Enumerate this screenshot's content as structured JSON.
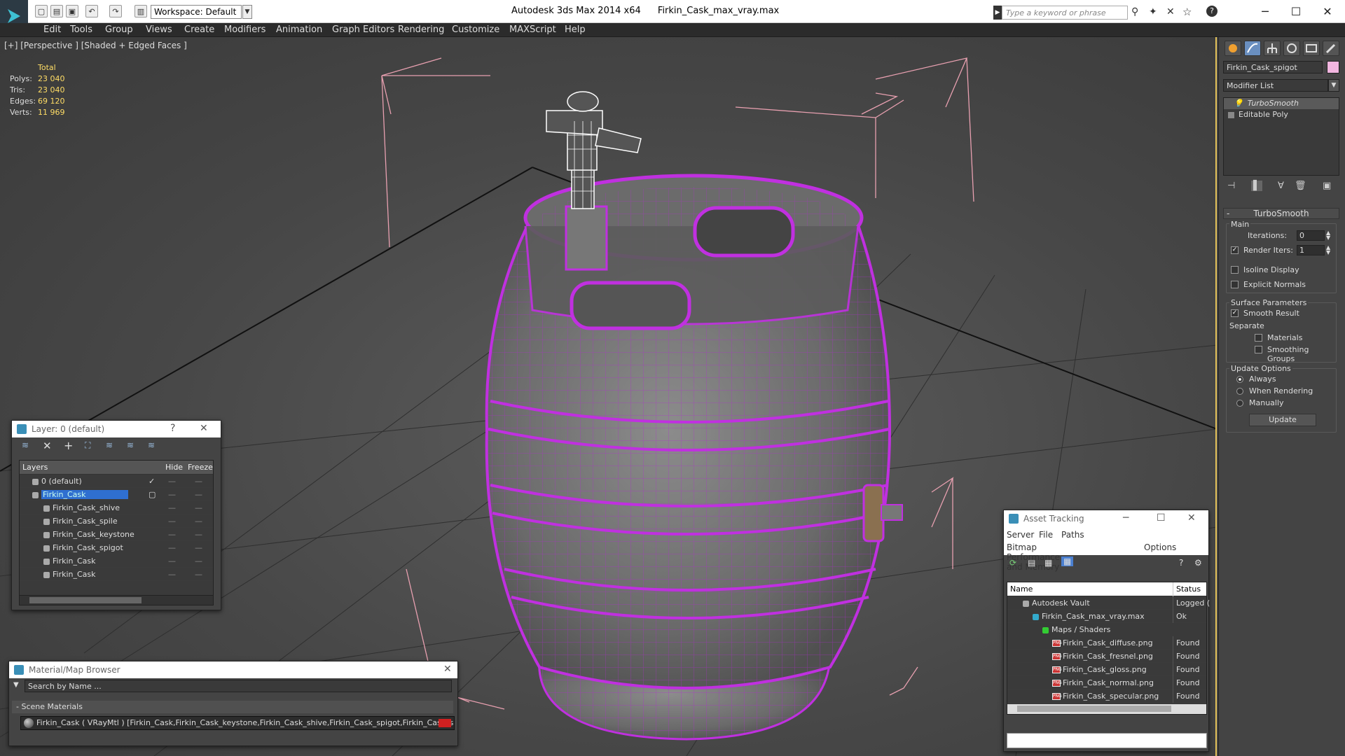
{
  "app": {
    "title": "Autodesk 3ds Max  2014 x64",
    "file": "Firkin_Cask_max_vray.max",
    "workspace": "Workspace: Default",
    "search_placeholder": "Type a keyword or phrase"
  },
  "menu": [
    "Edit",
    "Tools",
    "Group",
    "Views",
    "Create",
    "Modifiers",
    "Animation",
    "Graph Editors",
    "Rendering",
    "Customize",
    "MAXScript",
    "Help"
  ],
  "viewport": {
    "label": "[+] [Perspective ] [Shaded + Edged Faces ]",
    "stats": {
      "header": "Total",
      "rows": [
        {
          "k": "Polys:",
          "v": "23 040"
        },
        {
          "k": "Tris:",
          "v": "23 040"
        },
        {
          "k": "Edges:",
          "v": "69 120"
        },
        {
          "k": "Verts:",
          "v": "11 969"
        }
      ]
    }
  },
  "command_panel": {
    "object_name": "Firkin_Cask_spigot",
    "object_color": "#f2b6e0",
    "modifier_list": "Modifier List",
    "stack": [
      "TurboSmooth",
      "Editable Poly"
    ],
    "rollout_title": "TurboSmooth",
    "main_label": "Main",
    "iterations_label": "Iterations:",
    "iterations_value": "0",
    "render_iters_label": "Render Iters:",
    "render_iters_value": "1",
    "isoline": "Isoline Display",
    "explicit_normals": "Explicit Normals",
    "surface_params": "Surface Parameters",
    "smooth_result": "Smooth Result",
    "separate": "Separate",
    "materials": "Materials",
    "smoothing_groups": "Smoothing Groups",
    "update_options": "Update Options",
    "always": "Always",
    "when_rendering": "When Rendering",
    "manually": "Manually",
    "update_button": "Update"
  },
  "layer_panel": {
    "title": "Layer: 0 (default)",
    "help": "?",
    "columns": [
      "Layers",
      "Hide",
      "Freeze"
    ],
    "layers": [
      {
        "name": "0 (default)",
        "indent": 1,
        "selected": false
      },
      {
        "name": "Firkin_Cask",
        "indent": 1,
        "selected": true
      },
      {
        "name": "Firkin_Cask_shive",
        "indent": 2,
        "selected": false
      },
      {
        "name": "Firkin_Cask_spile",
        "indent": 2,
        "selected": false
      },
      {
        "name": "Firkin_Cask_keystone",
        "indent": 2,
        "selected": false
      },
      {
        "name": "Firkin_Cask_spigot",
        "indent": 2,
        "selected": false
      },
      {
        "name": "Firkin_Cask",
        "indent": 2,
        "selected": false
      },
      {
        "name": "Firkin_Cask",
        "indent": 2,
        "selected": false
      }
    ]
  },
  "material_browser": {
    "title": "Material/Map Browser",
    "search_placeholder": "Search by Name ...",
    "group": "Scene Materials",
    "item": "Firkin_Cask ( VRayMtl ) [Firkin_Cask,Firkin_Cask_keystone,Firkin_Cask_shive,Firkin_Cask_spigot,Firkin_Cask_s..."
  },
  "asset_tracking": {
    "title": "Asset Tracking",
    "menu1": [
      "Server",
      "File",
      "Paths"
    ],
    "menu2": [
      "Bitmap Performance and Memory",
      "Options"
    ],
    "columns": [
      "Name",
      "Status"
    ],
    "rows": [
      {
        "name": "Autodesk Vault",
        "status": "Logged (",
        "indent": 1,
        "icon": "vault"
      },
      {
        "name": "Firkin_Cask_max_vray.max",
        "status": "Ok",
        "indent": 2,
        "icon": "max"
      },
      {
        "name": "Maps / Shaders",
        "status": "",
        "indent": 3,
        "icon": "folder"
      },
      {
        "name": "Firkin_Cask_diffuse.png",
        "status": "Found",
        "indent": 4,
        "icon": "png"
      },
      {
        "name": "Firkin_Cask_fresnel.png",
        "status": "Found",
        "indent": 4,
        "icon": "png"
      },
      {
        "name": "Firkin_Cask_gloss.png",
        "status": "Found",
        "indent": 4,
        "icon": "png"
      },
      {
        "name": "Firkin_Cask_normal.png",
        "status": "Found",
        "indent": 4,
        "icon": "png"
      },
      {
        "name": "Firkin_Cask_specular.png",
        "status": "Found",
        "indent": 4,
        "icon": "png"
      }
    ]
  }
}
